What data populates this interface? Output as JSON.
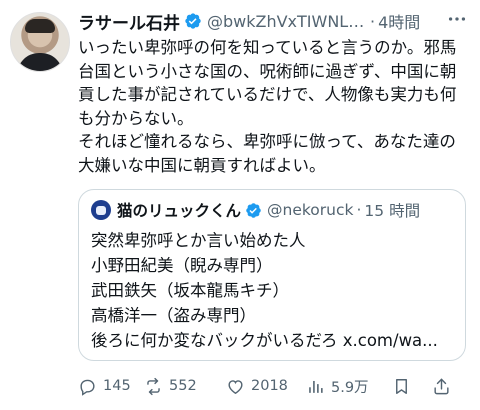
{
  "author": {
    "name": "ラサール石井",
    "handle": "@bwkZhVxTIWNLS…",
    "time": "4時間"
  },
  "body_text": "いったい卑弥呼の何を知っていると言うのか。邪馬台国という小さな国の、呪術師に過ぎず、中国に朝貢した事が記されているだけで、人物像も実力も何も分からない。\nそれほど憧れるなら、卑弥呼に倣って、あなた達の大嫌いな中国に朝貢すればよい。",
  "quote": {
    "name": "猫のリュックくん",
    "handle": "@nekoruck",
    "time": "15 時間",
    "text": "突然卑弥呼とか言い始めた人\n小野田紀美（睨み専門）\n武田鉄矢（坂本龍馬キチ）\n高橋洋一（盗み専門）\n後ろに何か変なバックがいるだろ x.com/wa..."
  },
  "actions": {
    "replies": "145",
    "reposts": "552",
    "likes": "2018",
    "views": "5.9万"
  },
  "colors": {
    "verified": "#1d9bf0",
    "muted": "#536471",
    "text": "#0f1419",
    "border": "#cfd9de"
  }
}
